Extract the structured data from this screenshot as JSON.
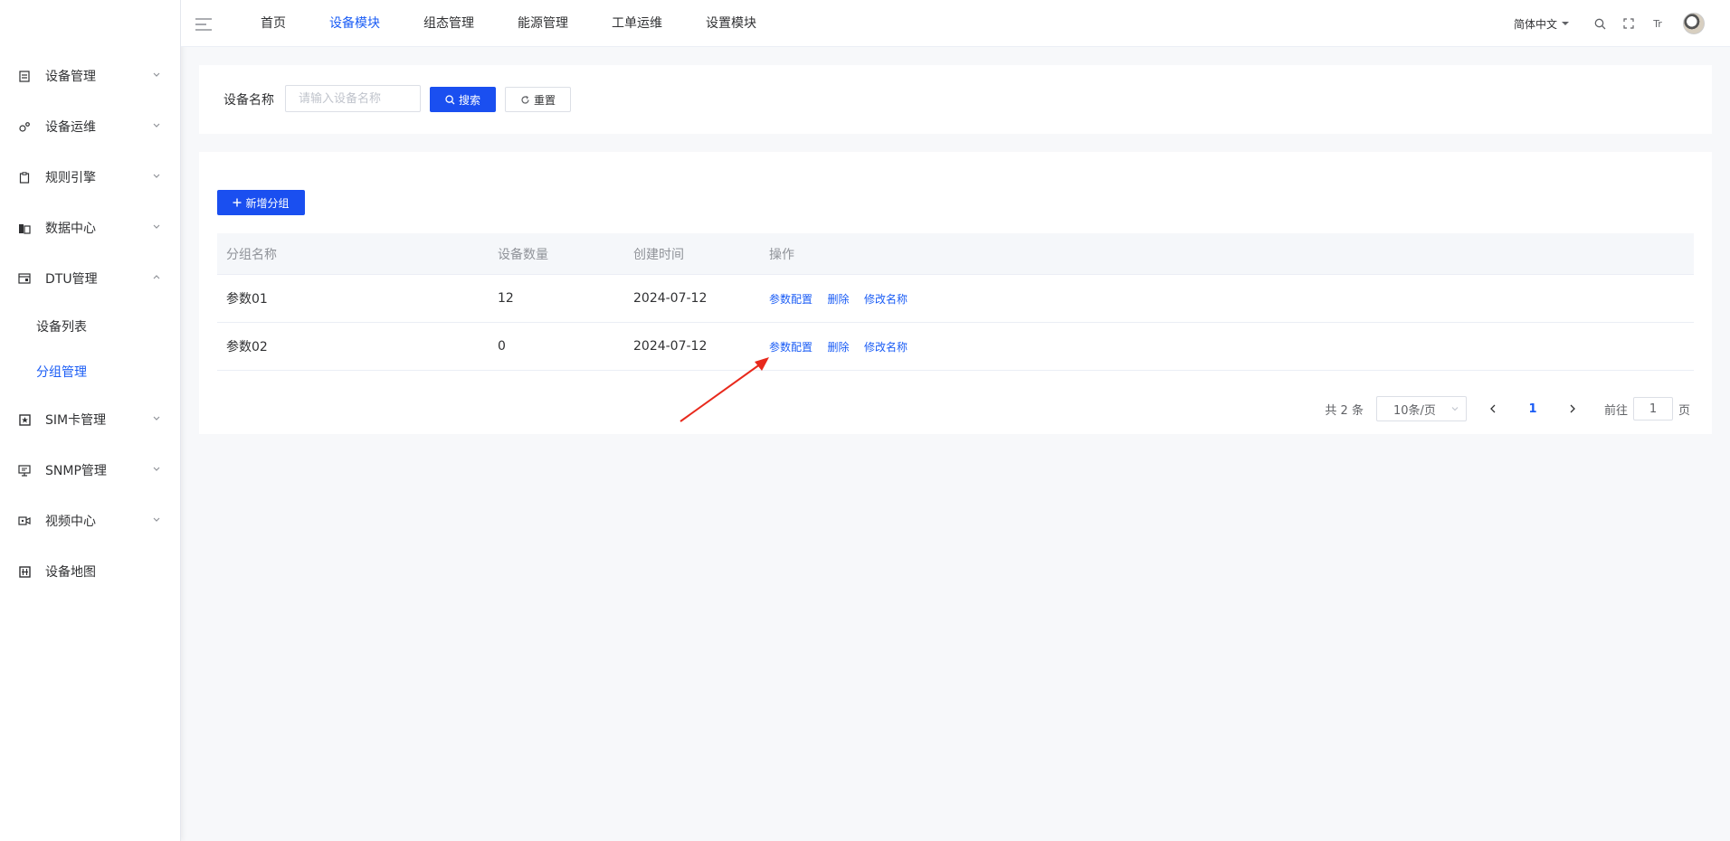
{
  "sidebar": {
    "items": [
      {
        "label": "设备管理",
        "icon": "device-icon",
        "expanded": false
      },
      {
        "label": "设备运维",
        "icon": "maintenance-icon",
        "expanded": false
      },
      {
        "label": "规则引擎",
        "icon": "clipboard-icon",
        "expanded": false
      },
      {
        "label": "数据中心",
        "icon": "database-icon",
        "expanded": false
      },
      {
        "label": "DTU管理",
        "icon": "dtu-icon",
        "expanded": true
      },
      {
        "label": "SIM卡管理",
        "icon": "sim-icon",
        "expanded": false
      },
      {
        "label": "SNMP管理",
        "icon": "monitor-icon",
        "expanded": false
      },
      {
        "label": "视频中心",
        "icon": "video-icon",
        "expanded": false
      },
      {
        "label": "设备地图",
        "icon": "map-grid-icon",
        "expanded": false
      }
    ],
    "dtu_sub": [
      {
        "label": "设备列表",
        "active": false
      },
      {
        "label": "分组管理",
        "active": true
      }
    ]
  },
  "topbar": {
    "nav": [
      "首页",
      "设备模块",
      "组态管理",
      "能源管理",
      "工单运维",
      "设置模块"
    ],
    "active_nav": "设备模块",
    "language": "简体中文",
    "font_size_icon_text": "Tr"
  },
  "search": {
    "label": "设备名称",
    "placeholder": "请输入设备名称",
    "value": "",
    "search_button": "搜索",
    "reset_button": "重置"
  },
  "table": {
    "add_button": "新增分组",
    "columns": [
      "分组名称",
      "设备数量",
      "创建时间",
      "操作"
    ],
    "rows": [
      {
        "name": "参数01",
        "count": "12",
        "created": "2024-07-12"
      },
      {
        "name": "参数02",
        "count": "0",
        "created": "2024-07-12"
      }
    ],
    "actions": [
      "参数配置",
      "删除",
      "修改名称"
    ]
  },
  "pagination": {
    "total": "共 2 条",
    "page_size": "10条/页",
    "current_page": "1",
    "goto_prefix": "前往",
    "goto_value": "1",
    "goto_suffix": "页"
  },
  "colors": {
    "primary": "#1a4ff0",
    "link": "#1a5cf5",
    "annotation_arrow": "#e8291c"
  }
}
